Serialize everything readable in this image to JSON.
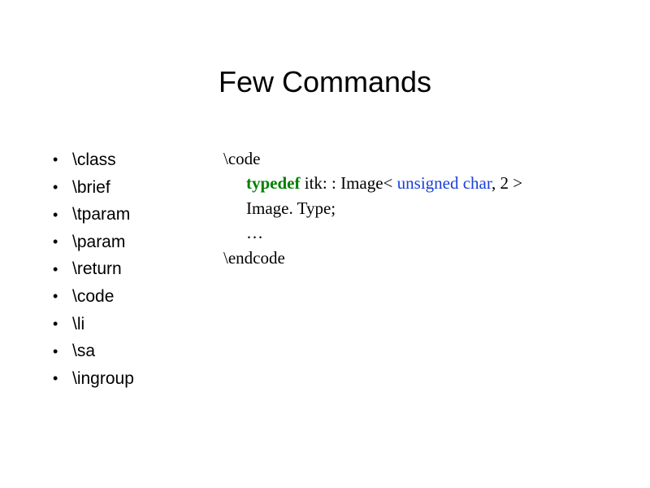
{
  "title": "Few Commands",
  "commands": {
    "items": [
      "\\class",
      "\\brief",
      "\\tparam",
      "\\param",
      "\\return",
      "\\code",
      "\\li",
      "\\sa",
      "\\ingroup"
    ]
  },
  "example": {
    "open": "\\code",
    "line1_kw": "typedef",
    "line1_rest": " itk: : Image< ",
    "line1_type": "unsigned char",
    "line1_tail": ", 2 >",
    "line2": "Image. Type;",
    "ellipsis": "…",
    "close": "\\endcode"
  },
  "bullet": "•"
}
